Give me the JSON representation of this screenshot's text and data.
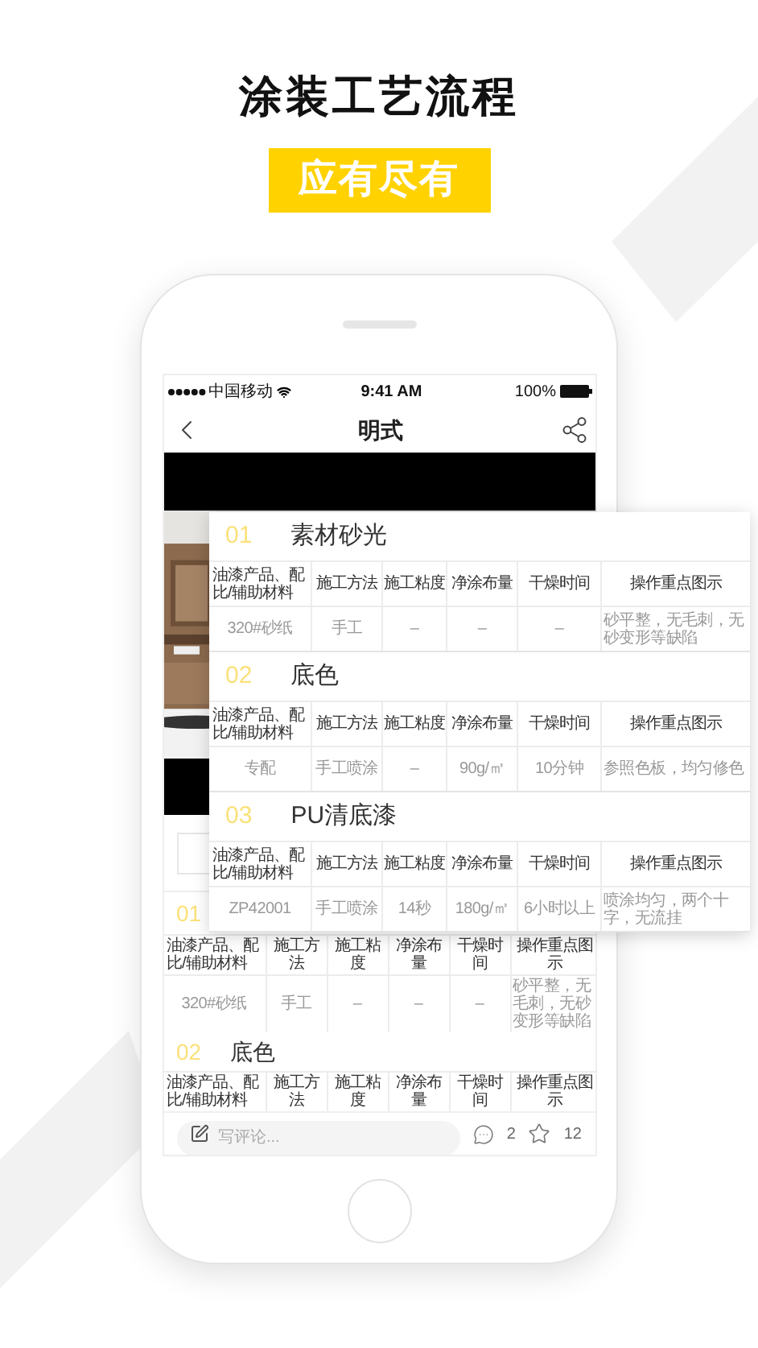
{
  "headline": "涂装工艺流程",
  "badge": "应有尽有",
  "status_bar": {
    "carrier": "中国移动",
    "time": "9:41 AM",
    "battery": "100%"
  },
  "nav": {
    "title": "明式"
  },
  "app_sections": [
    {
      "number": "01",
      "columns": [
        "油漆产品、配比/辅助材料",
        "施工方法",
        "施工粘度",
        "净涂布量",
        "干燥时间",
        "操作重点图示"
      ],
      "rows": [
        [
          "320#砂纸",
          "手工",
          "–",
          "–",
          "–",
          "砂平整，无毛刺，无砂变形等缺陷"
        ]
      ]
    },
    {
      "number": "02",
      "title": "底色",
      "columns": [
        "油漆产品、配比/辅助材料",
        "施工方法",
        "施工粘度",
        "净涂布量",
        "干燥时间",
        "操作重点图示"
      ]
    }
  ],
  "comment_bar": {
    "placeholder": "写评论...",
    "comments": "2",
    "favorites": "12"
  },
  "overlay_sections": [
    {
      "number": "01",
      "title": "素材砂光",
      "columns": [
        "油漆产品、配比/辅助材料",
        "施工方法",
        "施工粘度",
        "净涂布量",
        "干燥时间",
        "操作重点图示"
      ],
      "rows": [
        [
          "320#砂纸",
          "手工",
          "–",
          "–",
          "–",
          "砂平整，无毛刺，无砂变形等缺陷"
        ]
      ]
    },
    {
      "number": "02",
      "title": "底色",
      "columns": [
        "油漆产品、配比/辅助材料",
        "施工方法",
        "施工粘度",
        "净涂布量",
        "干燥时间",
        "操作重点图示"
      ],
      "rows": [
        [
          "专配",
          "手工喷涂",
          "–",
          "90g/㎡",
          "10分钟",
          "参照色板，均匀修色"
        ]
      ]
    },
    {
      "number": "03",
      "title": "PU清底漆",
      "columns": [
        "油漆产品、配比/辅助材料",
        "施工方法",
        "施工粘度",
        "净涂布量",
        "干燥时间",
        "操作重点图示"
      ],
      "rows": [
        [
          "ZP42001",
          "手工喷涂",
          "14秒",
          "180g/㎡",
          "6小时以上",
          "喷涂均匀，两个十字，无流挂"
        ]
      ]
    }
  ]
}
